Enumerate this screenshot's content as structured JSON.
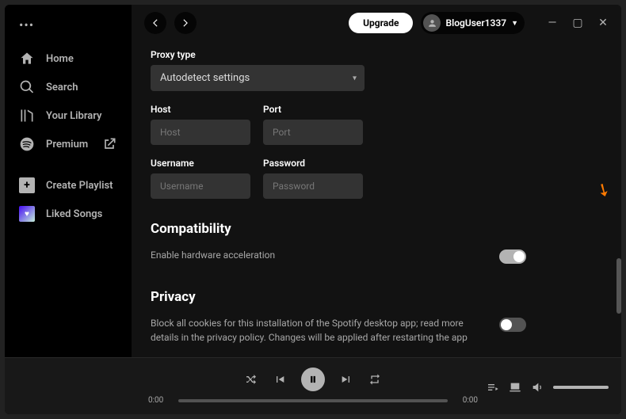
{
  "sidebar": {
    "items": [
      {
        "label": "Home"
      },
      {
        "label": "Search"
      },
      {
        "label": "Your Library"
      },
      {
        "label": "Premium"
      }
    ],
    "create_label": "Create Playlist",
    "liked_label": "Liked Songs"
  },
  "topbar": {
    "upgrade_label": "Upgrade",
    "username": "BlogUser1337"
  },
  "settings": {
    "proxy_type_label": "Proxy type",
    "proxy_type_value": "Autodetect settings",
    "host_label": "Host",
    "host_placeholder": "Host",
    "port_label": "Port",
    "port_placeholder": "Port",
    "username_label": "Username",
    "username_placeholder": "Username",
    "password_label": "Password",
    "password_placeholder": "Password",
    "compat_title": "Compatibility",
    "compat_text": "Enable hardware acceleration",
    "compat_on": true,
    "privacy_title": "Privacy",
    "privacy_text": "Block all cookies for this installation of the Spotify desktop app; read more details in the privacy policy. Changes will be applied after restarting the app",
    "privacy_on": false
  },
  "player": {
    "elapsed": "0:00",
    "total": "0:00"
  }
}
